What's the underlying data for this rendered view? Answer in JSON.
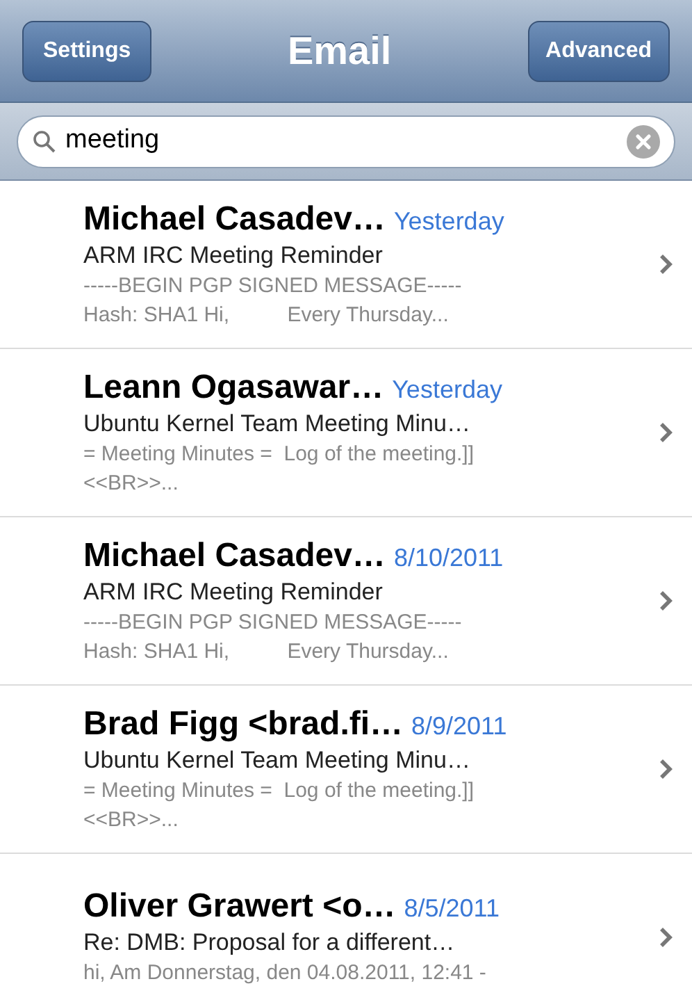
{
  "nav_bar": {
    "title": "Email",
    "left_button": "Settings",
    "right_button": "Advanced"
  },
  "search": {
    "value": "meeting"
  },
  "messages": [
    {
      "sender": "Michael Casadev…",
      "date": "Yesterday",
      "subject": "ARM IRC Meeting Reminder",
      "preview": [
        "-----BEGIN PGP SIGNED MESSAGE-----",
        "Hash: SHA1 Hi,          Every Thursday..."
      ]
    },
    {
      "sender": "Leann Ogasawar…",
      "date": "Yesterday",
      "subject": "Ubuntu Kernel Team Meeting Minu…",
      "preview": [
        "= Meeting Minutes =  Log of the meeting.]]",
        "<<BR>>..."
      ]
    },
    {
      "sender": "Michael Casadev…",
      "date": "8/10/2011",
      "subject": "ARM IRC Meeting Reminder",
      "preview": [
        "-----BEGIN PGP SIGNED MESSAGE-----",
        "Hash: SHA1 Hi,          Every Thursday..."
      ]
    },
    {
      "sender": "Brad Figg <brad.fi…",
      "date": "8/9/2011",
      "subject": "Ubuntu Kernel Team Meeting Minu…",
      "preview": [
        "= Meeting Minutes =  Log of the meeting.]]",
        "<<BR>>..."
      ]
    },
    {
      "sender": "Oliver Grawert <o…",
      "date": "8/5/2011",
      "subject": "Re: DMB: Proposal for a different…",
      "preview": [
        "hi, Am Donnerstag, den 04.08.2011, 12:41 -"
      ]
    }
  ]
}
